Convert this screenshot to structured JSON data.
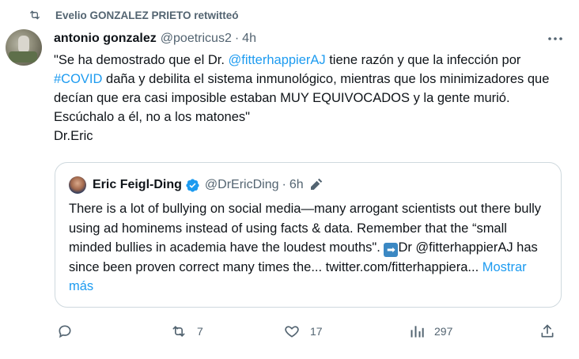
{
  "retweet": {
    "icon": "retweet-icon",
    "text": "Evelio GONZALEZ PRIETO retwitteó"
  },
  "tweet": {
    "author_name": "antonio gonzalez",
    "handle": "@poetricus2",
    "separator": "·",
    "time": "4h",
    "text_part1": "\"Se ha demostrado que el Dr. ",
    "mention": "@fitterhappierAJ",
    "text_part2": " tiene razón y que la infección por ",
    "hashtag": "#COVID",
    "text_part3": " daña y debilita el sistema inmunológico, mientras que los minimizadores que decían que era casi imposible estaban MUY EQUIVOCADOS y la gente murió. Escúchalo a él, no a los matones\"",
    "signature": "Dr.Eric"
  },
  "quote": {
    "author_name": "Eric Feigl-Ding",
    "handle": "@DrEricDing",
    "separator": "·",
    "time": "6h",
    "text_part1": "There is a lot of bullying on social media—many arrogant scientists out there bully using ad hominems instead of using facts & data. Remember that the “small minded bullies in academia have the loudest mouths\". ",
    "text_part2": "Dr @fitterhappierAJ has since been proven correct many times the... twitter.com/fitterhappiera...",
    "show_more": "Mostrar más"
  },
  "actions": {
    "reply": {
      "icon": "reply-icon",
      "count": ""
    },
    "retweet": {
      "icon": "retweet-icon",
      "count": "7"
    },
    "like": {
      "icon": "heart-icon",
      "count": "17"
    },
    "views": {
      "icon": "views-icon",
      "count": "297"
    },
    "share": {
      "icon": "share-icon",
      "count": ""
    }
  },
  "colors": {
    "accent": "#1d9bf0",
    "muted": "#536471",
    "text": "#0f1419",
    "border": "#cfd9de"
  }
}
